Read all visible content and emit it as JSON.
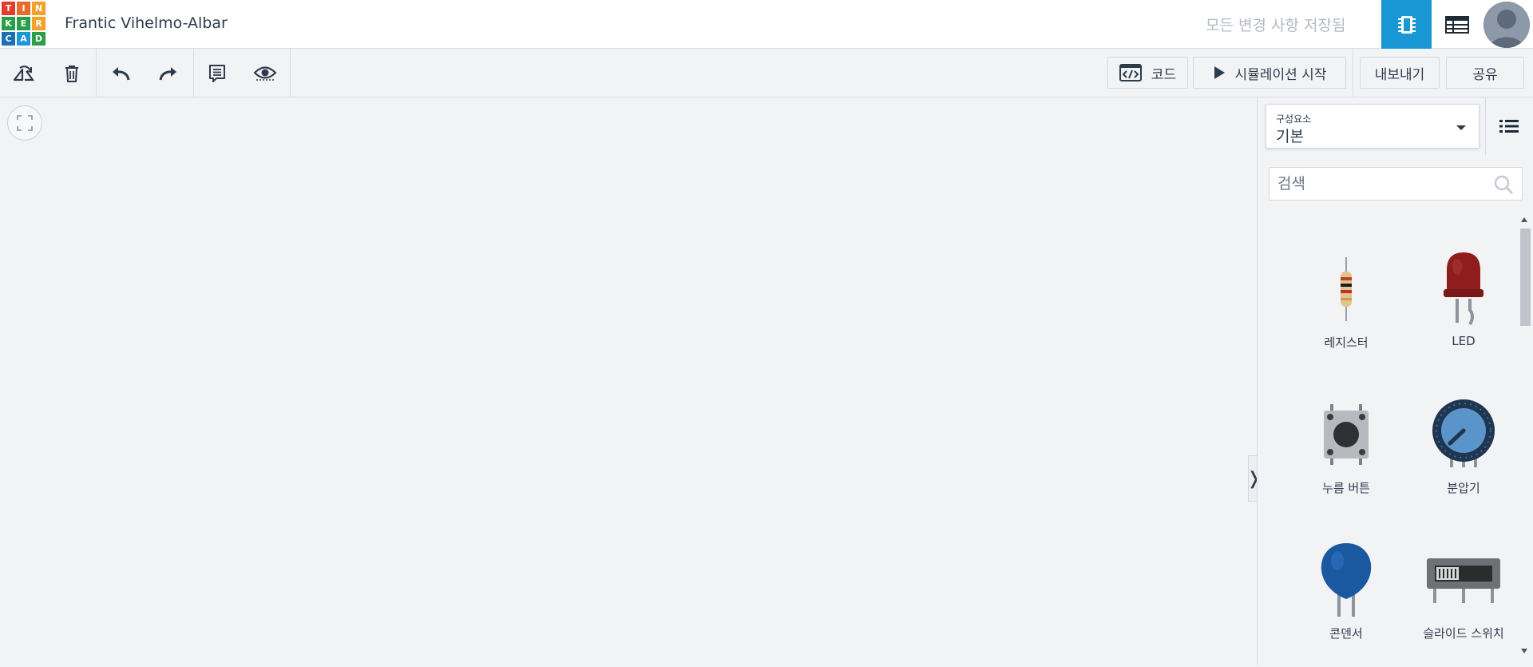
{
  "header": {
    "logo_letters": [
      "T",
      "I",
      "N",
      "K",
      "E",
      "R",
      "C",
      "A",
      "D"
    ],
    "logo_colors": [
      "#e13c2d",
      "#e96c2d",
      "#f3a12a",
      "#2a9e49",
      "#2a9e49",
      "#f3a12a",
      "#1a6fb5",
      "#1a98d5",
      "#2a9e49"
    ],
    "title": "Frantic Vihelmo-Albar",
    "save_status": "모든 변경 사항 저장됨",
    "circuit_view_icon": "chip-icon",
    "component_list_icon": "table-icon",
    "accent_color": "#1a98d5"
  },
  "toolbar": {
    "rotate_icon": "rotate-icon",
    "delete_icon": "trash-icon",
    "undo_icon": "undo-icon",
    "redo_icon": "redo-icon",
    "notes_icon": "notes-icon",
    "visibility_icon": "eye-icon",
    "code_label": "코드",
    "start_sim_label": "시뮬레이션 시작",
    "export_label": "내보내기",
    "share_label": "공유"
  },
  "panel": {
    "category_label": "구성요소",
    "category_value": "기본",
    "search_placeholder": "검색",
    "components": [
      {
        "label": "레지스터",
        "icon": "resistor-icon"
      },
      {
        "label": "LED",
        "icon": "led-icon"
      },
      {
        "label": "누름 버튼",
        "icon": "pushbutton-icon"
      },
      {
        "label": "분압기",
        "icon": "potentiometer-icon"
      },
      {
        "label": "콘덴서",
        "icon": "capacitor-icon"
      },
      {
        "label": "슬라이드 스위치",
        "icon": "slide-switch-icon"
      }
    ]
  }
}
